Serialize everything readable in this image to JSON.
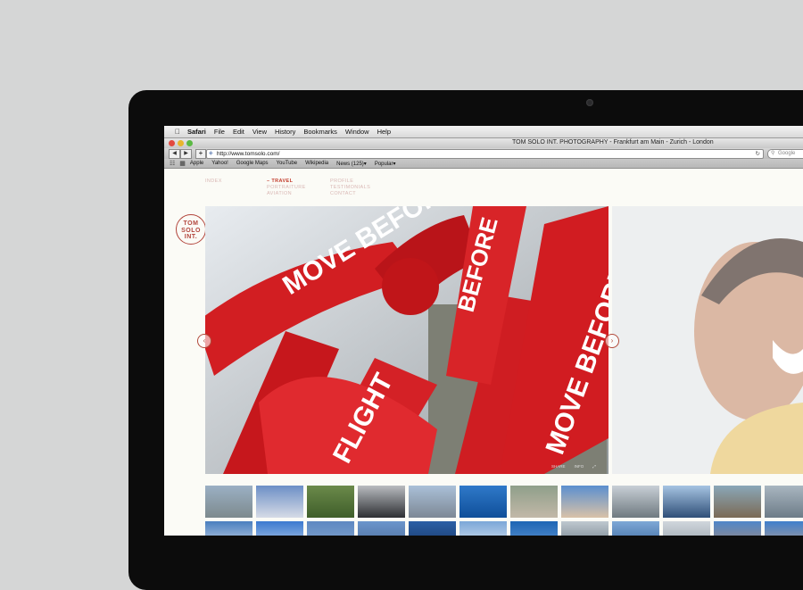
{
  "menubar": {
    "apple_icon": "apple-icon",
    "items": [
      "Safari",
      "File",
      "Edit",
      "View",
      "History",
      "Bookmarks",
      "Window",
      "Help"
    ]
  },
  "window": {
    "title": "TOM SOLO INT. PHOTOGRAPHY - Frankfurt am Main - Zurich - London"
  },
  "toolbar": {
    "back_icon": "back-arrow-icon",
    "forward_icon": "forward-arrow-icon",
    "add_icon": "plus-icon",
    "url": "http://www.tomsolo.com/",
    "reload_icon": "reload-icon",
    "search_placeholder": "Google"
  },
  "bookmarks": {
    "items": [
      "Apple",
      "Yahoo!",
      "Google Maps",
      "YouTube",
      "Wikipedia",
      "News (125)▾",
      "Popular▾"
    ]
  },
  "site": {
    "nav_col1": [
      "INDEX"
    ],
    "nav_col2": [
      "– TRAVEL",
      "PORTRAITURE",
      "AVIATION"
    ],
    "nav_col3": [
      "PROFILE",
      "TESTIMONIALS",
      "CONTACT"
    ],
    "logo_lines": [
      "TOM",
      "SOLO",
      "INT."
    ],
    "prev_icon": "chevron-left-icon",
    "next_icon": "chevron-right-icon",
    "hero_text": [
      "MOVE BEFORE",
      "BEFORE",
      "FLIGHT",
      "MOVE BEFORE"
    ],
    "hero_tools": [
      "SHARE",
      "INFO",
      "⤢"
    ],
    "accent_color": "#c23a2a"
  }
}
